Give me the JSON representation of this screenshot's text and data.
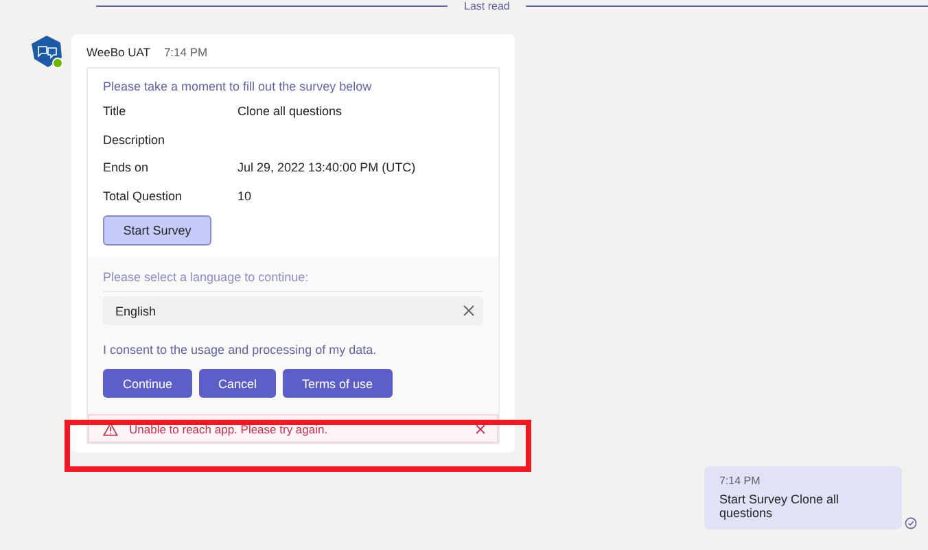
{
  "divider": {
    "label": "Last read"
  },
  "message": {
    "sender": "WeeBo UAT",
    "time": "7:14 PM",
    "card": {
      "heading": "Please take a moment to fill out the survey below",
      "facts": [
        {
          "label": "Title",
          "value": "Clone all questions"
        },
        {
          "label": "Description"
        },
        {
          "label": "Ends on",
          "value": "Jul 29, 2022 13:40:00 PM (UTC)"
        },
        {
          "label": "Total Question",
          "value": "10"
        }
      ],
      "start_button": "Start Survey",
      "language_prompt": "Please select a language to continue:",
      "language_value": "English",
      "consent": "I consent to the usage and processing of my data.",
      "buttons": [
        "Continue",
        "Cancel",
        "Terms of use"
      ]
    },
    "error": {
      "text": "Unable to reach app. Please try again."
    }
  },
  "sent": {
    "time": "7:14 PM",
    "text": "Start Survey Clone all questions"
  }
}
